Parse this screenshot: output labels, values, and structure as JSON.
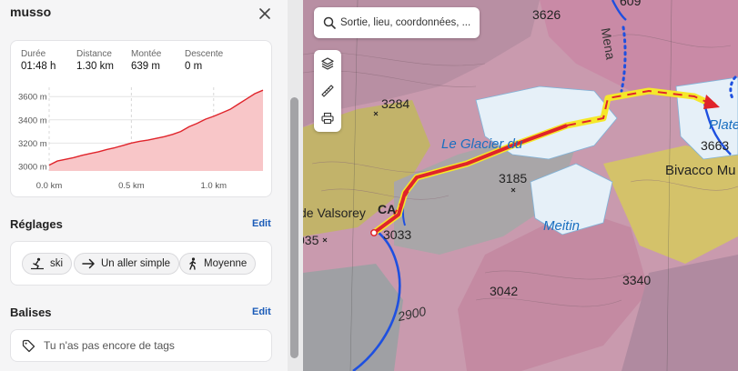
{
  "trip": {
    "title": "musso"
  },
  "stats": [
    {
      "label": "Durée",
      "value": "01:48 h"
    },
    {
      "label": "Distance",
      "value": "1.30 km"
    },
    {
      "label": "Montée",
      "value": "639 m"
    },
    {
      "label": "Descente",
      "value": "0 m"
    }
  ],
  "chart_data": {
    "type": "area",
    "x": [
      0.0,
      0.05,
      0.1,
      0.15,
      0.2,
      0.25,
      0.3,
      0.35,
      0.4,
      0.45,
      0.5,
      0.55,
      0.6,
      0.65,
      0.7,
      0.75,
      0.8,
      0.85,
      0.9,
      0.95,
      1.0,
      1.05,
      1.1,
      1.15,
      1.2,
      1.25,
      1.3
    ],
    "y": [
      3010,
      3045,
      3060,
      3075,
      3095,
      3110,
      3125,
      3145,
      3160,
      3180,
      3200,
      3215,
      3225,
      3240,
      3255,
      3275,
      3300,
      3340,
      3370,
      3405,
      3430,
      3460,
      3490,
      3535,
      3580,
      3625,
      3655
    ],
    "xlim": [
      0.0,
      1.3
    ],
    "ylim": [
      2960,
      3680
    ],
    "x_ticks": [
      "0.0 km",
      "0.5 km",
      "1.0 km"
    ],
    "x_tick_values": [
      0.0,
      0.5,
      1.0
    ],
    "y_ticks": [
      "3000 m",
      "3200 m",
      "3400 m",
      "3600 m"
    ],
    "y_tick_values": [
      3000,
      3200,
      3400,
      3600
    ],
    "grid": true,
    "line_color": "#e0242b",
    "fill_color": "#f8c6c8"
  },
  "settings": {
    "title": "Réglages",
    "edit_label": "Edit",
    "chips": [
      {
        "icon": "ski-icon",
        "label": "ski"
      },
      {
        "icon": "arrow-right-icon",
        "label": "Un aller simple"
      },
      {
        "icon": "hiker-icon",
        "label": "Moyenne"
      }
    ]
  },
  "tags": {
    "title": "Balises",
    "edit_label": "Edit",
    "placeholder": "Tu n'as pas encore de tags"
  },
  "search": {
    "placeholder": "Sortie, lieu, coordonnées, ..."
  },
  "map": {
    "labels": [
      "3626",
      "3284",
      "Le Glacier du",
      "3185",
      "Meitin",
      "3033",
      "de Valsorey",
      "CA",
      "035",
      "3042",
      "2900",
      "3340",
      "3663",
      "Bivacco Mu",
      "Plate",
      "609",
      "Mena"
    ]
  },
  "colors": {
    "accent": "#1a5bb8",
    "route_red": "#e0242b",
    "route_yellow": "#f5e82a",
    "route_blue": "#1e50e0"
  }
}
